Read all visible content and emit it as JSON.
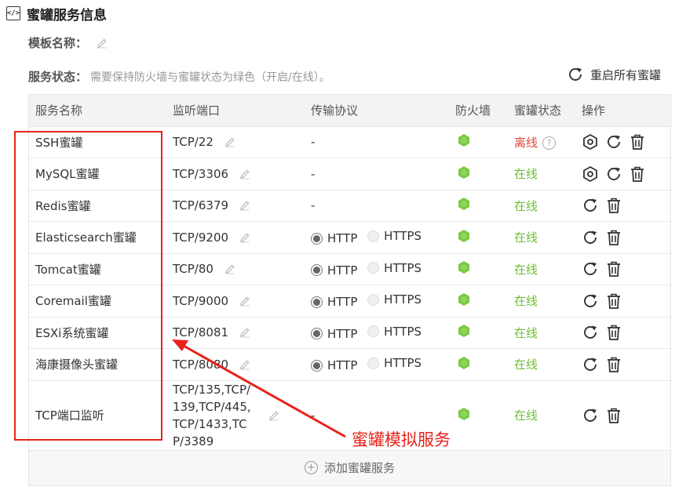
{
  "header": {
    "icon": "code-icon",
    "title": "蜜罐服务信息"
  },
  "template": {
    "label": "模板名称：",
    "value": ""
  },
  "service_status": {
    "label": "服务状态：",
    "hint": "需要保持防火墙与蜜罐状态为绿色（开启/在线）。"
  },
  "restart_all": {
    "label": "重启所有蜜罐"
  },
  "table": {
    "headers": [
      "服务名称",
      "监听端口",
      "传输协议",
      "防火墙",
      "蜜罐状态",
      "操作"
    ],
    "rows": [
      {
        "name": "SSH蜜罐",
        "port": "TCP/22",
        "protocol": "-",
        "status": "离线"
      },
      {
        "name": "MySQL蜜罐",
        "port": "TCP/3306",
        "protocol": "-",
        "status": "在线"
      },
      {
        "name": "Redis蜜罐",
        "port": "TCP/6379",
        "protocol": "-",
        "status": "在线"
      },
      {
        "name": "Elasticsearch蜜罐",
        "port": "TCP/9200",
        "status": "在线"
      },
      {
        "name": "Tomcat蜜罐",
        "port": "TCP/80",
        "status": "在线"
      },
      {
        "name": "Coremail蜜罐",
        "port": "TCP/9000",
        "status": "在线"
      },
      {
        "name": "ESXi系统蜜罐",
        "port": "TCP/8081",
        "status": "在线"
      },
      {
        "name": "海康摄像头蜜罐",
        "port": "TCP/8080",
        "status": "在线"
      },
      {
        "name": "TCP端口监听",
        "port": "TCP/135,TCP/139,TCP/445,TCP/1433,TCP/3389",
        "protocol": "-",
        "status": "在线"
      }
    ],
    "protocol_options": [
      "HTTP",
      "HTTPS"
    ],
    "help_mark": "?"
  },
  "add_service": {
    "label": "添加蜜罐服务"
  },
  "annotation": {
    "text": "蜜罐模拟服务"
  },
  "colors": {
    "online": "#6cbf33",
    "offline": "#e0453a",
    "firewall": "#7ac943",
    "annotation": "#e8231a"
  }
}
